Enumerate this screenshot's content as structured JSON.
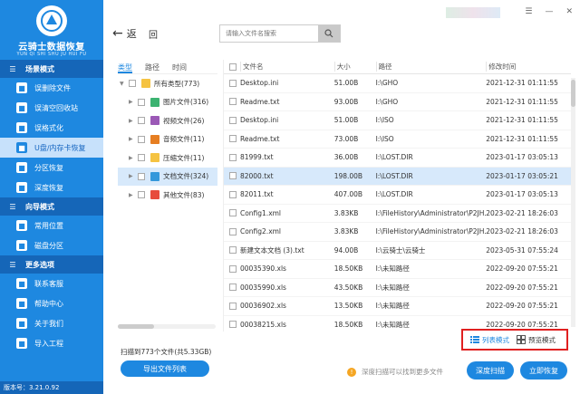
{
  "sidebar": {
    "logo_title": "云骑士数据恢复",
    "logo_sub": "YUN QI SHI SHU JU HUI FU",
    "sections": [
      {
        "title": "场景模式",
        "items": [
          {
            "label": "误删除文件",
            "active": false
          },
          {
            "label": "误清空回收站",
            "active": false
          },
          {
            "label": "误格式化",
            "active": false
          },
          {
            "label": "U盘/内存卡恢复",
            "active": true
          },
          {
            "label": "分区恢复",
            "active": false
          },
          {
            "label": "深度恢复",
            "active": false
          }
        ]
      },
      {
        "title": "向导模式",
        "items": [
          {
            "label": "常用位置",
            "active": false
          },
          {
            "label": "磁盘分区",
            "active": false
          }
        ]
      },
      {
        "title": "更多选项",
        "items": [
          {
            "label": "联系客服",
            "active": false
          },
          {
            "label": "帮助中心",
            "active": false
          },
          {
            "label": "关于我们",
            "active": false
          },
          {
            "label": "导入工程",
            "active": false
          }
        ]
      }
    ],
    "version": "版本号：3.21.0.92"
  },
  "topbar": {
    "back_label": "返",
    "home_label": "回",
    "search_placeholder": "请输入文件名搜索"
  },
  "tree": {
    "tabs": [
      "类型",
      "路径",
      "时间"
    ],
    "items": [
      {
        "label": "所有类型(773)",
        "color": "#f5c342",
        "expander": "▼",
        "level": 0,
        "selected": false
      },
      {
        "label": "图片文件(316)",
        "color": "#3cb371",
        "expander": "▶",
        "level": 1,
        "selected": false
      },
      {
        "label": "视频文件(26)",
        "color": "#9b59b6",
        "expander": "▶",
        "level": 1,
        "selected": false
      },
      {
        "label": "音频文件(11)",
        "color": "#e67e22",
        "expander": "▶",
        "level": 1,
        "selected": false
      },
      {
        "label": "压缩文件(11)",
        "color": "#f5c342",
        "expander": "▶",
        "level": 1,
        "selected": false
      },
      {
        "label": "文档文件(324)",
        "color": "#3498db",
        "expander": "▶",
        "level": 1,
        "selected": true
      },
      {
        "label": "其他文件(83)",
        "color": "#e74c3c",
        "expander": "▶",
        "level": 1,
        "selected": false
      }
    ]
  },
  "table": {
    "headers": {
      "name": "文件名",
      "size": "大小",
      "path": "路径",
      "time": "修改时间"
    },
    "rows": [
      {
        "name": "Desktop.ini",
        "size": "51.00B",
        "path": "I:\\GHO",
        "time": "2021-12-31 01:11:55",
        "selected": false
      },
      {
        "name": "Readme.txt",
        "size": "93.00B",
        "path": "I:\\GHO",
        "time": "2021-12-31 01:11:55",
        "selected": false
      },
      {
        "name": "Desktop.ini",
        "size": "51.00B",
        "path": "I:\\ISO",
        "time": "2021-12-31 01:11:55",
        "selected": false
      },
      {
        "name": "Readme.txt",
        "size": "73.00B",
        "path": "I:\\ISO",
        "time": "2021-12-31 01:11:55",
        "selected": false
      },
      {
        "name": "81999.txt",
        "size": "36.00B",
        "path": "I:\\LOST.DIR",
        "time": "2023-01-17 03:05:13",
        "selected": false
      },
      {
        "name": "82000.txt",
        "size": "198.00B",
        "path": "I:\\LOST.DIR",
        "time": "2023-01-17 03:05:21",
        "selected": true
      },
      {
        "name": "82011.txt",
        "size": "407.00B",
        "path": "I:\\LOST.DIR",
        "time": "2023-01-17 03:05:13",
        "selected": false
      },
      {
        "name": "Config1.xml",
        "size": "3.83KB",
        "path": "I:\\FileHistory\\Administrator\\P2JH...",
        "time": "2023-02-21 18:26:03",
        "selected": false
      },
      {
        "name": "Config2.xml",
        "size": "3.83KB",
        "path": "I:\\FileHistory\\Administrator\\P2JH...",
        "time": "2023-02-21 18:26:03",
        "selected": false
      },
      {
        "name": "新建文本文档 (3).txt",
        "size": "94.00B",
        "path": "I:\\云骑士\\云骑士",
        "time": "2023-05-31 07:55:24",
        "selected": false
      },
      {
        "name": "00035390.xls",
        "size": "18.50KB",
        "path": "I:\\未知路径",
        "time": "2022-09-20 07:55:21",
        "selected": false
      },
      {
        "name": "00035990.xls",
        "size": "43.50KB",
        "path": "I:\\未知路径",
        "time": "2022-09-20 07:55:21",
        "selected": false
      },
      {
        "name": "00036902.xls",
        "size": "13.50KB",
        "path": "I:\\未知路径",
        "time": "2022-09-20 07:55:21",
        "selected": false
      },
      {
        "name": "00038215.xls",
        "size": "18.50KB",
        "path": "I:\\未知路径",
        "time": "2022-09-20 07:55:21",
        "selected": false
      }
    ]
  },
  "footer": {
    "stats": "扫描到773个文件(共5.33GB)",
    "export_label": "导出文件列表",
    "list_mode": "列表模式",
    "preview_mode": "预览模式",
    "hint": "深度扫描可以找到更多文件",
    "deep_scan": "深度扫描",
    "recover": "立即恢复"
  }
}
